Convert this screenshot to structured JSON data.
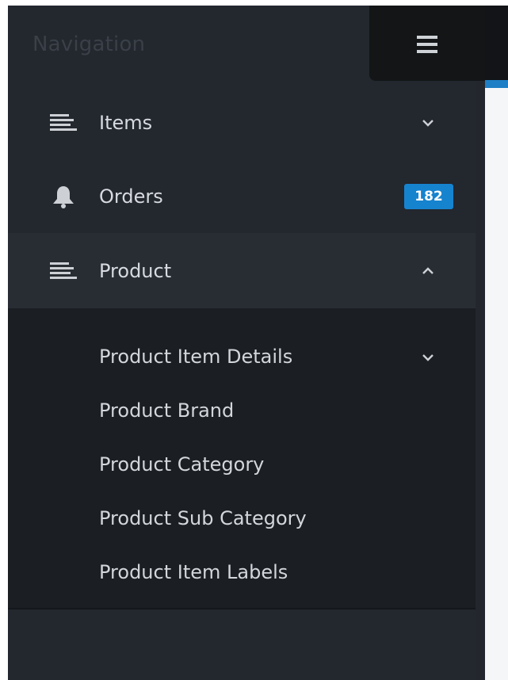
{
  "sidebar": {
    "title": "Navigation",
    "toggle_icon": "hamburger-menu-icon",
    "items": [
      {
        "label": "Items",
        "icon": "list-lines-icon",
        "chevron": "down"
      },
      {
        "label": "Orders",
        "icon": "bell-icon",
        "badge": "182",
        "badge_color": "#1683cf"
      },
      {
        "label": "Product",
        "icon": "list-lines-icon",
        "chevron": "up",
        "expanded": true
      }
    ],
    "submenu": [
      {
        "label": "Product Item Details",
        "chevron": "down"
      },
      {
        "label": "Product Brand"
      },
      {
        "label": "Product Category"
      },
      {
        "label": "Product Sub Category"
      },
      {
        "label": "Product Item Labels"
      }
    ]
  },
  "colors": {
    "sidebar_bg": "#23272e",
    "submenu_bg": "#1b1e23",
    "active_bg": "#282d34",
    "accent": "#1e7fc6"
  }
}
